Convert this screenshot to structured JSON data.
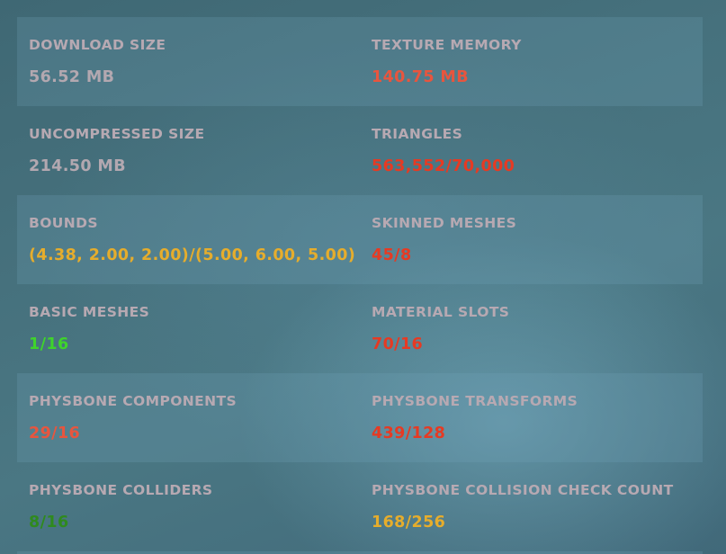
{
  "colors": {
    "label": "#b7a9b2",
    "neutral": "#b3a8b0",
    "orange_red": "#e8553e",
    "red": "#e63a23",
    "yellow": "#e6ad2c",
    "bright_green": "#3fd42b",
    "dark_green": "#2f8a1e"
  },
  "stats": [
    {
      "left": {
        "label": "DOWNLOAD SIZE",
        "value": "56.52 MB",
        "color": "#b3a8b0"
      },
      "right": {
        "label": "TEXTURE MEMORY",
        "value": "140.75 MB",
        "color": "#e8553e"
      }
    },
    {
      "left": {
        "label": "UNCOMPRESSED SIZE",
        "value": "214.50 MB",
        "color": "#b3a8b0"
      },
      "right": {
        "label": "TRIANGLES",
        "value": "563,552/70,000",
        "color": "#e63a23"
      }
    },
    {
      "left": {
        "label": "BOUNDS",
        "value": "(4.38, 2.00, 2.00)/(5.00, 6.00, 5.00)",
        "color": "#e6ad2c"
      },
      "right": {
        "label": "SKINNED MESHES",
        "value": "45/8",
        "color": "#e63a23"
      }
    },
    {
      "left": {
        "label": "BASIC MESHES",
        "value": "1/16",
        "color": "#3fd42b"
      },
      "right": {
        "label": "MATERIAL SLOTS",
        "value": "70/16",
        "color": "#e63a23"
      }
    },
    {
      "left": {
        "label": "PHYSBONE COMPONENTS",
        "value": "29/16",
        "color": "#e8553e"
      },
      "right": {
        "label": "PHYSBONE TRANSFORMS",
        "value": "439/128",
        "color": "#e63a23"
      }
    },
    {
      "left": {
        "label": "PHYSBONE COLLIDERS",
        "value": "8/16",
        "color": "#2f8a1e"
      },
      "right": {
        "label": "PHYSBONE COLLISION CHECK COUNT",
        "value": "168/256",
        "color": "#e6ad2c"
      }
    }
  ]
}
